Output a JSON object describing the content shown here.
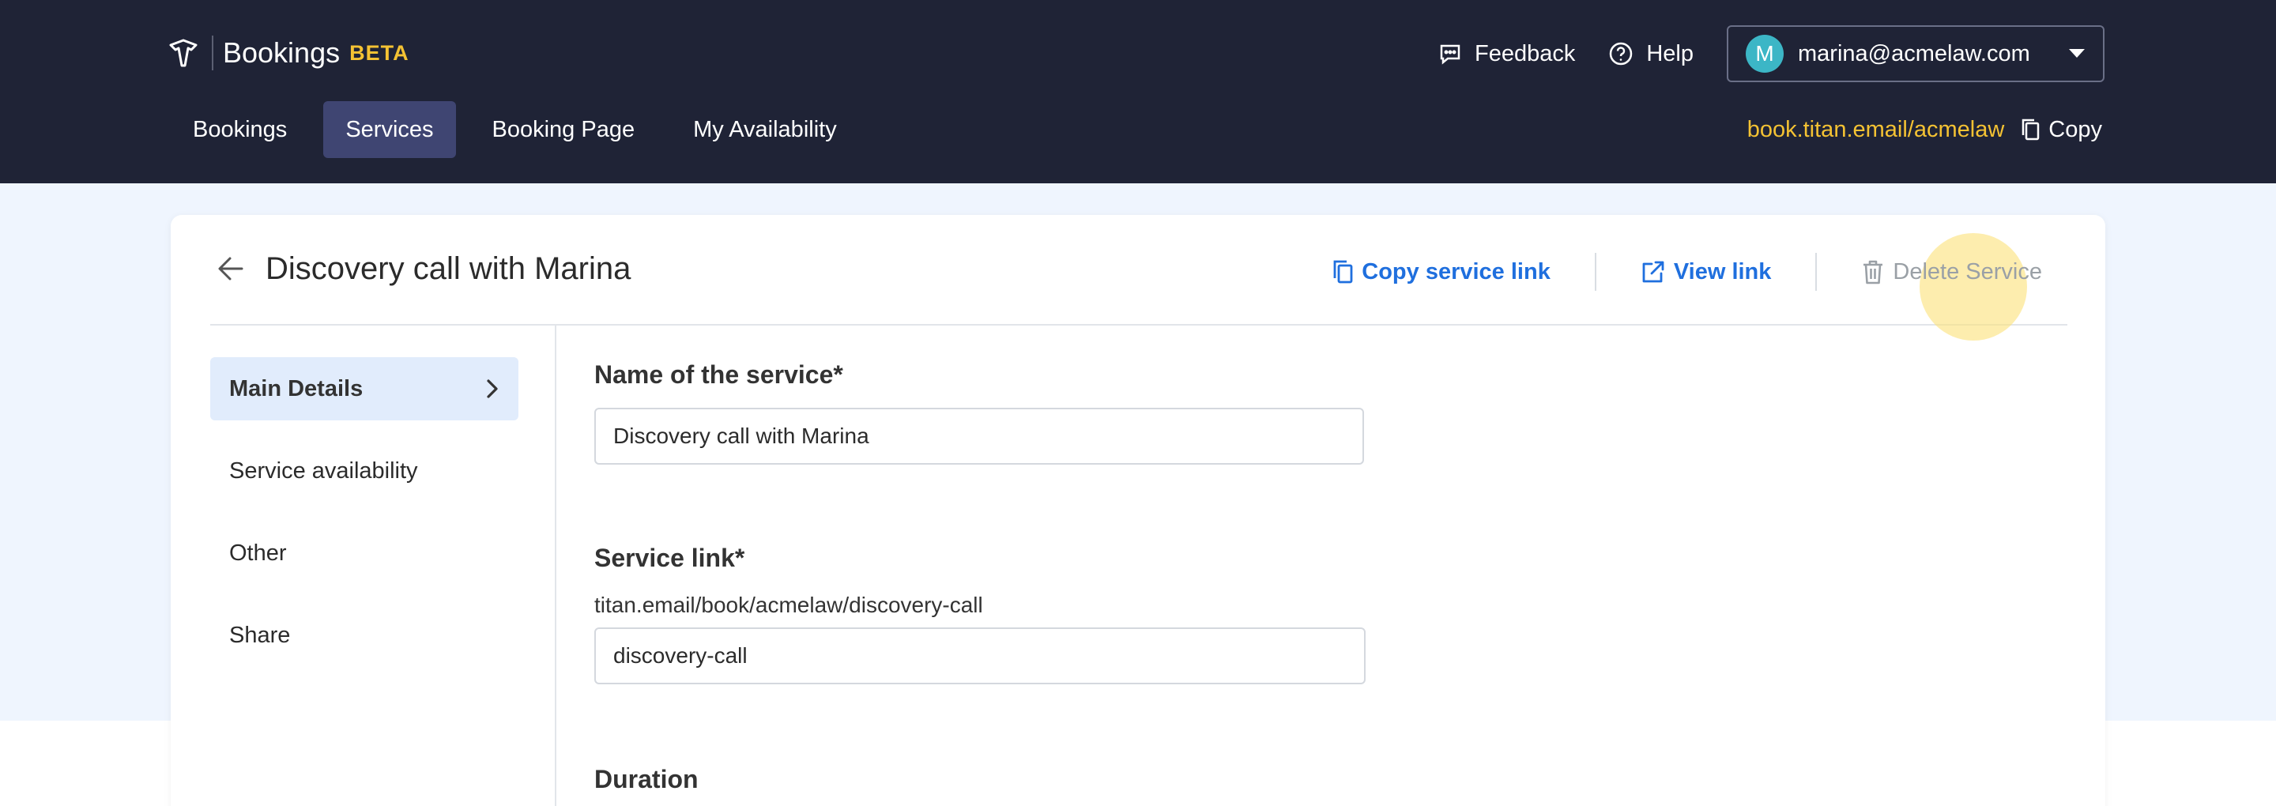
{
  "header": {
    "app_name": "Bookings",
    "beta_badge": "BETA",
    "feedback_label": "Feedback",
    "help_label": "Help",
    "account": {
      "initial": "M",
      "email": "marina@acmelaw.com"
    },
    "tabs": [
      {
        "label": "Bookings",
        "active": false
      },
      {
        "label": "Services",
        "active": true
      },
      {
        "label": "Booking Page",
        "active": false
      },
      {
        "label": "My Availability",
        "active": false
      }
    ],
    "booking_url": "book.titan.email/acmelaw",
    "copy_label": "Copy"
  },
  "service": {
    "title": "Discovery call with Marina",
    "actions": {
      "copy_link": "Copy service link",
      "view_link": "View link",
      "delete": "Delete Service"
    }
  },
  "sidebar": {
    "items": [
      {
        "label": "Main Details",
        "active": true
      },
      {
        "label": "Service availability",
        "active": false
      },
      {
        "label": "Other",
        "active": false
      },
      {
        "label": "Share",
        "active": false
      }
    ]
  },
  "form": {
    "name_label": "Name of the service*",
    "name_value": "Discovery call with Marina",
    "link_label": "Service link*",
    "link_prefix": "titan.email/book/acmelaw/discovery-call",
    "link_value": "discovery-call",
    "duration_label": "Duration"
  },
  "colors": {
    "topbar": "#1f2336",
    "active_tab": "#3f4572",
    "accent_yellow": "#f4c233",
    "link_blue": "#1f6fde",
    "page_band": "#eff5fe",
    "sidebar_active": "#e1ecfc"
  }
}
